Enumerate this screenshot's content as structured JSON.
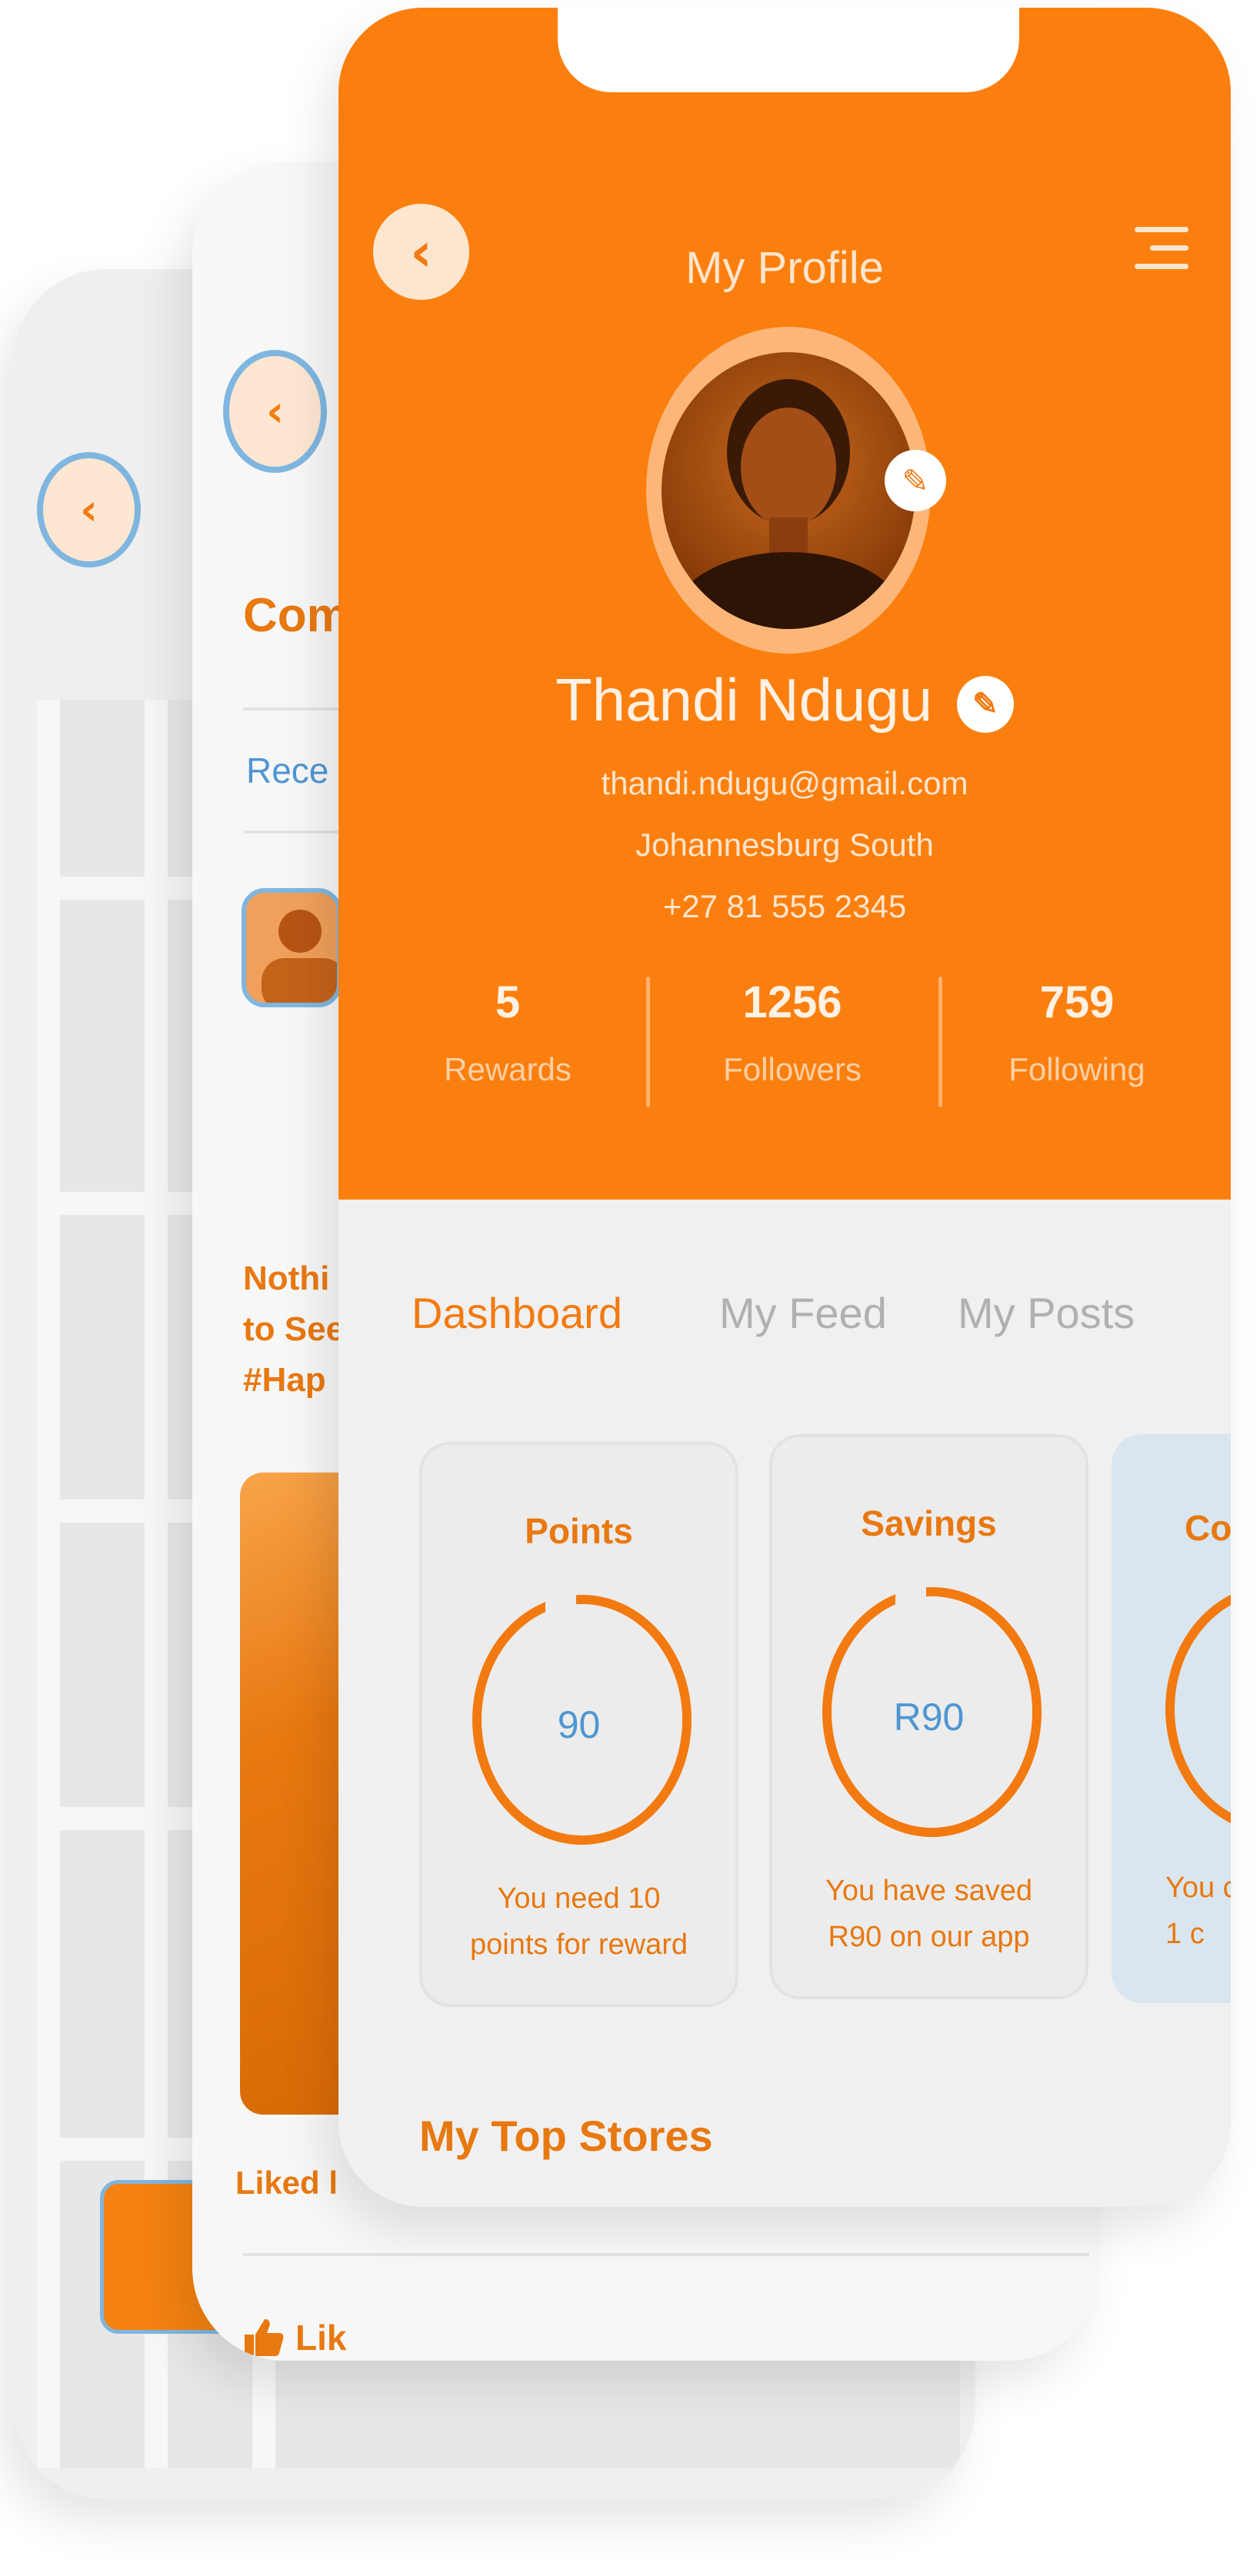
{
  "back_screen": {
    "orange_button_label": ""
  },
  "community_screen": {
    "title": "Com",
    "tab_recent": "Rece",
    "post_text": "Nothi\nto See\n#Hap",
    "liked_text": "Liked l",
    "like_label": "Lik"
  },
  "profile_screen": {
    "title": "My Profile",
    "user": {
      "name": "Thandi Ndugu",
      "email": "thandi.ndugu@gmail.com",
      "location": "Johannesburg South",
      "phone": "+27 81 555 2345"
    },
    "stats": [
      {
        "value": "5",
        "label": "Rewards"
      },
      {
        "value": "1256",
        "label": "Followers"
      },
      {
        "value": "759",
        "label": "Following"
      }
    ],
    "tabs": [
      {
        "label": "Dashboard",
        "active": true
      },
      {
        "label": "My Feed",
        "active": false
      },
      {
        "label": "My Posts",
        "active": false
      }
    ],
    "cards": [
      {
        "title": "Points",
        "value": "90",
        "description": "You need 10\npoints for reward"
      },
      {
        "title": "Savings",
        "value": "R90",
        "description": "You have saved\nR90 on our app"
      }
    ],
    "partial_card": {
      "title": "Co",
      "description": "You c\n1 c"
    },
    "section_title": "My Top Stores"
  },
  "colors": {
    "brand_orange": "#fb7f0e",
    "accent_blue": "#4f96d2",
    "text_orange": "#e87810"
  }
}
